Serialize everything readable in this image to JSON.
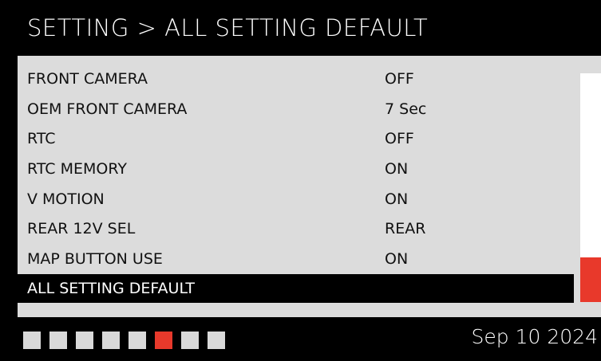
{
  "header": {
    "title": "SETTING > ALL SETTING DEFAULT"
  },
  "menu": {
    "items": [
      {
        "label": "FRONT CAMERA",
        "value": "OFF"
      },
      {
        "label": "OEM FRONT CAMERA",
        "value": "7 Sec"
      },
      {
        "label": "RTC",
        "value": "OFF"
      },
      {
        "label": "RTC MEMORY",
        "value": "ON"
      },
      {
        "label": "V MOTION",
        "value": "ON"
      },
      {
        "label": "REAR 12V SEL",
        "value": "REAR"
      },
      {
        "label": "MAP BUTTON USE",
        "value": "ON"
      },
      {
        "label": "ALL SETTING DEFAULT",
        "value": ""
      }
    ],
    "selected_index": 7
  },
  "pager": {
    "total": 8,
    "active_index": 5
  },
  "footer": {
    "date": "Sep 10 2024"
  },
  "colors": {
    "accent": "#e8392b",
    "panel": "#dcdcdc",
    "background": "#000000"
  }
}
